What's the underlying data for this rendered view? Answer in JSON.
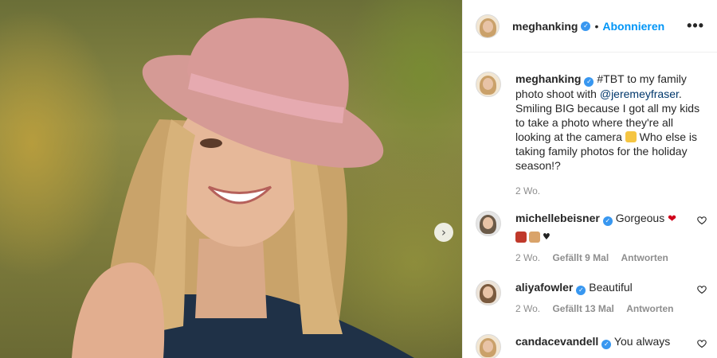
{
  "post": {
    "username": "meghanking",
    "follow_label": "Abonnieren",
    "separator": "•",
    "more_label": "•••",
    "next_label": "›"
  },
  "caption": {
    "username": "meghanking",
    "text_before": "#TBT to my family photo shoot with ",
    "mention": "@jeremeyfraser",
    "text_after": ". Smiling BIG because I got all my kids to take a photo where they're all looking at the camera ",
    "text_end": " Who else is taking family photos for the holiday season!?",
    "time": "2 Wo."
  },
  "comments": [
    {
      "username": "michellebeisner",
      "text": "Gorgeous",
      "time": "2 Wo.",
      "likes": "Gefällt 9 Mal",
      "reply": "Antworten"
    },
    {
      "username": "aliyafowler",
      "text": "Beautiful",
      "time": "2 Wo.",
      "likes": "Gefällt 13 Mal",
      "reply": "Antworten"
    },
    {
      "username": "candacevandell",
      "text": "You always"
    }
  ],
  "colors": {
    "accent": "#0095f6",
    "verified": "#3897f0",
    "muted": "#8e8e8e"
  }
}
